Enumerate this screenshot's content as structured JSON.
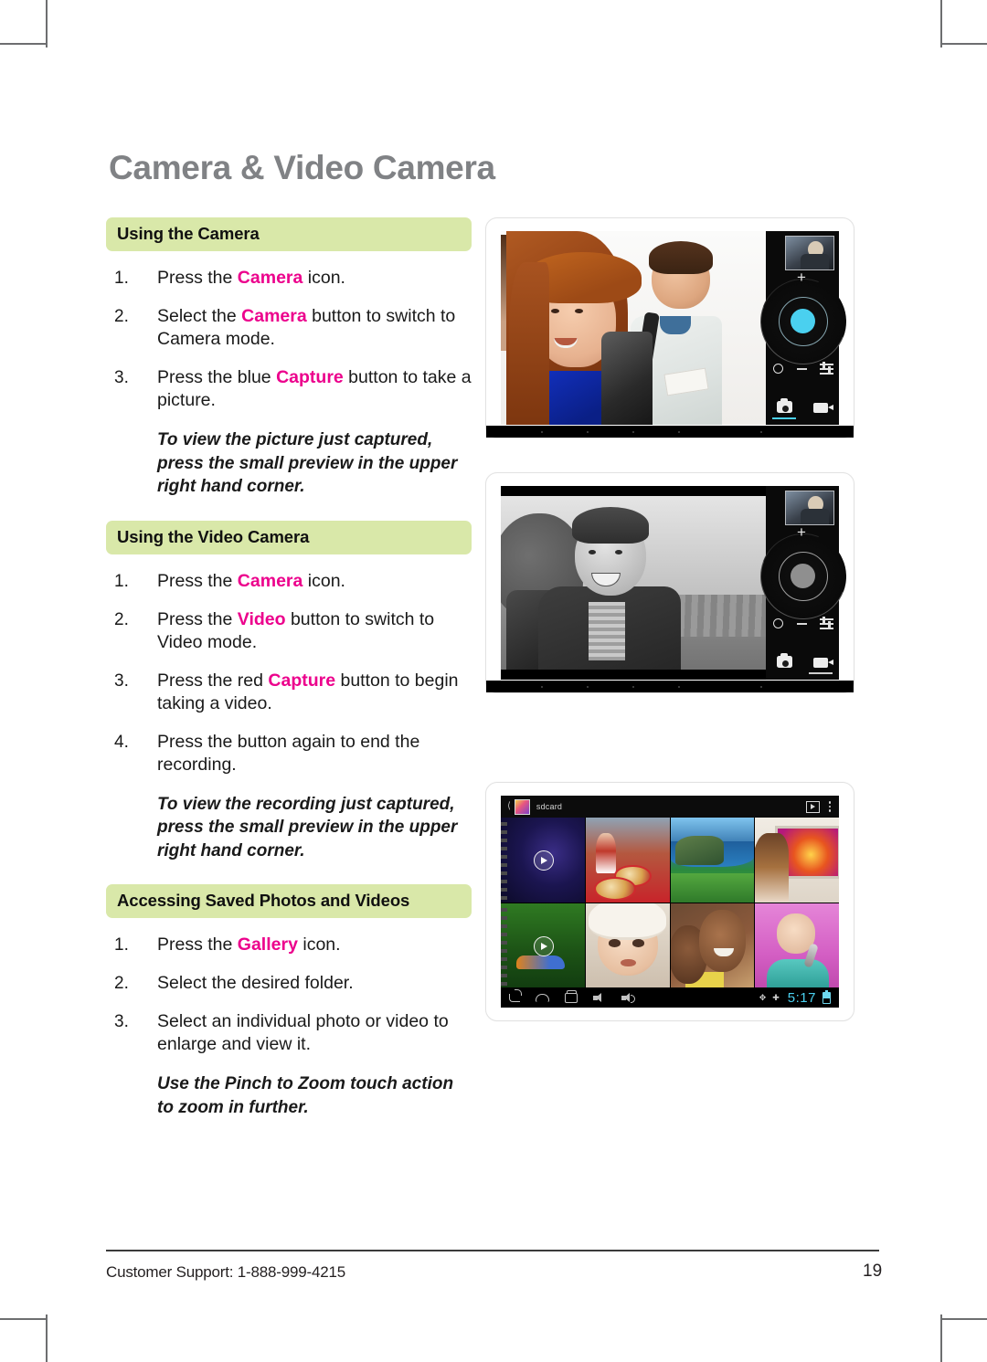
{
  "page": {
    "title": "Camera & Video Camera",
    "footer_support": "Customer Support: 1-888-999-4215",
    "page_number": "19"
  },
  "sections": [
    {
      "heading": "Using the Camera",
      "steps": [
        {
          "num": "1.",
          "pre": "Press the ",
          "highlight": "Camera",
          "post": " icon."
        },
        {
          "num": "2.",
          "pre": "Select the ",
          "highlight": "Camera",
          "post": " button to switch to Camera mode."
        },
        {
          "num": "3.",
          "pre": "Press the blue ",
          "highlight": "Capture",
          "post": " button to take a picture."
        }
      ],
      "note": "To view the picture just captured, press the small preview in the upper right hand corner."
    },
    {
      "heading": "Using the Video Camera",
      "steps": [
        {
          "num": "1.",
          "pre": "Press the ",
          "highlight": "Camera",
          "post": " icon."
        },
        {
          "num": "2.",
          "pre": "Press the ",
          "highlight": "Video",
          "post": " button to switch to Video mode."
        },
        {
          "num": "3.",
          "pre": "Press the red ",
          "highlight": "Capture",
          "post": " button to begin taking a video."
        },
        {
          "num": "4.",
          "pre": "Press the button again to end the recording.",
          "highlight": "",
          "post": ""
        }
      ],
      "note": "To view the recording just captured, press the small preview in the upper right hand corner."
    },
    {
      "heading": "Accessing Saved Photos and Videos",
      "steps": [
        {
          "num": "1.",
          "pre": "Press the ",
          "highlight": "Gallery",
          "post": " icon."
        },
        {
          "num": "2.",
          "pre": "Select the desired folder.",
          "highlight": "",
          "post": ""
        },
        {
          "num": "3.",
          "pre": "Select an individual photo or video to enlarge and view it.",
          "highlight": "",
          "post": ""
        }
      ],
      "note": "Use the Pinch to Zoom touch action to zoom in further."
    }
  ],
  "screenshots": {
    "camera": {
      "caption_icons": {
        "shutter": "shutter-button",
        "zoom_in": "+",
        "zoom_out": "−",
        "settings": "settings-sliders-icon",
        "mode_photo": "camera-mode-icon",
        "mode_video": "video-mode-icon"
      },
      "active_mode": "photo",
      "shutter_color": "#4ad0ef"
    },
    "video": {
      "active_mode": "video",
      "shutter_color": "#8f8f8f"
    },
    "gallery": {
      "folder_label": "sdcard",
      "clock": "5:17",
      "nav_items": [
        "back",
        "home",
        "recents",
        "volume-down",
        "volume-up"
      ],
      "status_items": [
        "bluetooth",
        "sync"
      ],
      "appbar_actions": [
        "slideshow",
        "overflow-menu"
      ]
    }
  },
  "colors": {
    "heading_band": "#d9e8a9",
    "highlight": "#ec008c",
    "title_gray": "#808285",
    "accent_cyan": "#4ad0ef"
  }
}
